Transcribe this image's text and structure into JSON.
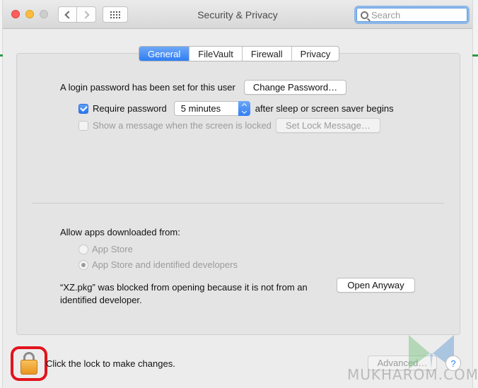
{
  "window": {
    "title": "Security & Privacy"
  },
  "search": {
    "placeholder": "Search",
    "value": ""
  },
  "tabs": [
    {
      "label": "General",
      "active": true
    },
    {
      "label": "FileVault",
      "active": false
    },
    {
      "label": "Firewall",
      "active": false
    },
    {
      "label": "Privacy",
      "active": false
    }
  ],
  "general": {
    "login_text": "A login password has been set for this user",
    "change_password_button": "Change Password…",
    "require_password": {
      "label": "Require password",
      "checked": true,
      "select_value": "5 minutes",
      "suffix": "after sleep or screen saver begins"
    },
    "show_message": {
      "label": "Show a message when the screen is locked",
      "checked": false,
      "enabled": false,
      "button": "Set Lock Message…"
    },
    "allow_apps": {
      "heading": "Allow apps downloaded from:",
      "options": [
        {
          "label": "App Store",
          "selected": false,
          "enabled": false
        },
        {
          "label": "App Store and identified developers",
          "selected": true,
          "enabled": false
        }
      ]
    },
    "blocked": {
      "line1": "“XZ.pkg” was blocked from opening because it is not from an",
      "line2": "identified developer.",
      "button": "Open Anyway"
    }
  },
  "footer": {
    "lock_text": "Click the lock to make changes.",
    "advanced_button": "Advanced…",
    "help_button": "?"
  },
  "watermark": {
    "text": "MUKHAROM.COM"
  },
  "colors": {
    "accent": "#2f7ef3",
    "highlight_ring": "#e2141c",
    "lock": "#e79522"
  }
}
